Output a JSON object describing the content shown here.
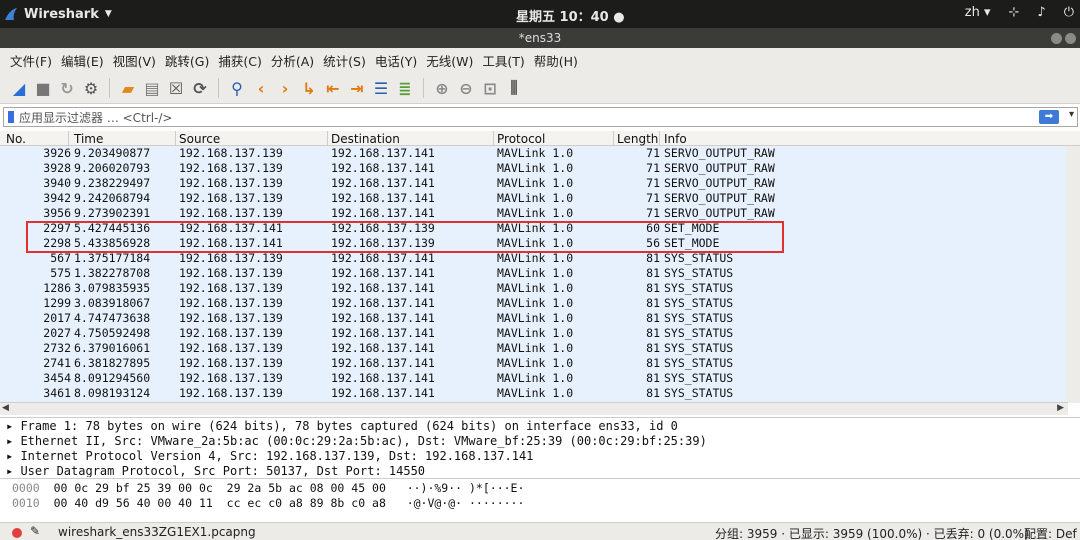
{
  "system": {
    "app_name": "Wireshark",
    "clock": "星期五 10：40",
    "lang": "zh"
  },
  "window": {
    "title": "*ens33"
  },
  "menu": [
    "文件(F)",
    "编辑(E)",
    "视图(V)",
    "跳转(G)",
    "捕获(C)",
    "分析(A)",
    "统计(S)",
    "电话(Y)",
    "无线(W)",
    "工具(T)",
    "帮助(H)"
  ],
  "filter": {
    "placeholder": "应用显示过滤器 … <Ctrl-/>"
  },
  "columns": [
    "No.",
    "Time",
    "Source",
    "Destination",
    "Protocol",
    "Length",
    "Info"
  ],
  "packets": [
    [
      "3926",
      "9.203490877",
      "192.168.137.139",
      "192.168.137.141",
      "MAVLink 1.0",
      "71",
      "SERVO_OUTPUT_RAW"
    ],
    [
      "3928",
      "9.206020793",
      "192.168.137.139",
      "192.168.137.141",
      "MAVLink 1.0",
      "71",
      "SERVO_OUTPUT_RAW"
    ],
    [
      "3940",
      "9.238229497",
      "192.168.137.139",
      "192.168.137.141",
      "MAVLink 1.0",
      "71",
      "SERVO_OUTPUT_RAW"
    ],
    [
      "3942",
      "9.242068794",
      "192.168.137.139",
      "192.168.137.141",
      "MAVLink 1.0",
      "71",
      "SERVO_OUTPUT_RAW"
    ],
    [
      "3956",
      "9.273902391",
      "192.168.137.139",
      "192.168.137.141",
      "MAVLink 1.0",
      "71",
      "SERVO_OUTPUT_RAW"
    ],
    [
      "2297",
      "5.427445136",
      "192.168.137.141",
      "192.168.137.139",
      "MAVLink 1.0",
      "60",
      "SET_MODE"
    ],
    [
      "2298",
      "5.433856928",
      "192.168.137.141",
      "192.168.137.139",
      "MAVLink 1.0",
      "56",
      "SET_MODE"
    ],
    [
      "567",
      "1.375177184",
      "192.168.137.139",
      "192.168.137.141",
      "MAVLink 1.0",
      "81",
      "SYS_STATUS"
    ],
    [
      "575",
      "1.382278708",
      "192.168.137.139",
      "192.168.137.141",
      "MAVLink 1.0",
      "81",
      "SYS_STATUS"
    ],
    [
      "1286",
      "3.079835935",
      "192.168.137.139",
      "192.168.137.141",
      "MAVLink 1.0",
      "81",
      "SYS_STATUS"
    ],
    [
      "1299",
      "3.083918067",
      "192.168.137.139",
      "192.168.137.141",
      "MAVLink 1.0",
      "81",
      "SYS_STATUS"
    ],
    [
      "2017",
      "4.747473638",
      "192.168.137.139",
      "192.168.137.141",
      "MAVLink 1.0",
      "81",
      "SYS_STATUS"
    ],
    [
      "2027",
      "4.750592498",
      "192.168.137.139",
      "192.168.137.141",
      "MAVLink 1.0",
      "81",
      "SYS_STATUS"
    ],
    [
      "2732",
      "6.379016061",
      "192.168.137.139",
      "192.168.137.141",
      "MAVLink 1.0",
      "81",
      "SYS_STATUS"
    ],
    [
      "2741",
      "6.381827895",
      "192.168.137.139",
      "192.168.137.141",
      "MAVLink 1.0",
      "81",
      "SYS_STATUS"
    ],
    [
      "3454",
      "8.091294560",
      "192.168.137.139",
      "192.168.137.141",
      "MAVLink 1.0",
      "81",
      "SYS_STATUS"
    ],
    [
      "3461",
      "8.098193124",
      "192.168.137.139",
      "192.168.137.141",
      "MAVLink 1.0",
      "81",
      "SYS_STATUS"
    ]
  ],
  "details": [
    "Frame 1: 78 bytes on wire (624 bits), 78 bytes captured (624 bits) on interface ens33, id 0",
    "Ethernet II, Src: VMware_2a:5b:ac (00:0c:29:2a:5b:ac), Dst: VMware_bf:25:39 (00:0c:29:bf:25:39)",
    "Internet Protocol Version 4, Src: 192.168.137.139, Dst: 192.168.137.141",
    "User Datagram Protocol, Src Port: 50137, Dst Port: 14550"
  ],
  "bytes": [
    {
      "offset": "0000",
      "hex": "00 0c 29 bf 25 39 00 0c  29 2a 5b ac 08 00 45 00",
      "ascii": "··)·%9·· )*[···E·"
    },
    {
      "offset": "0010",
      "hex": "00 40 d9 56 40 00 40 11  cc ec c0 a8 89 8b c0 a8",
      "ascii": "·@·V@·@· ········"
    }
  ],
  "status": {
    "file": "wireshark_ens33ZG1EX1.pcapng",
    "stats": "分组: 3959 · 已显示: 3959 (100.0%) · 已丢弃: 0 (0.0%)",
    "profile": "配置: Def"
  },
  "colors": {
    "row_bg": "#e7f1fd",
    "highlight_box": "#e03131"
  }
}
